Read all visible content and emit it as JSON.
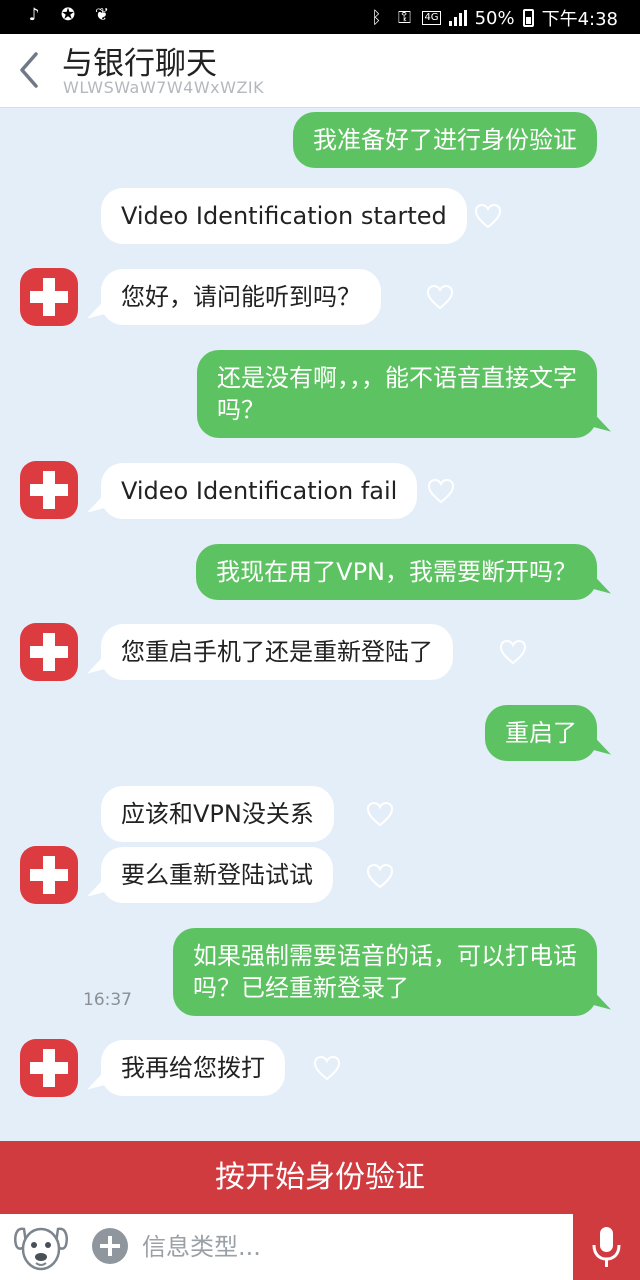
{
  "status_bar": {
    "battery": "50%",
    "time": "下午4:38",
    "network": "4G"
  },
  "header": {
    "title": "与银行聊天",
    "subtitle": "WLWSWaW7W4WxWZIK"
  },
  "messages": [
    {
      "side": "out",
      "text": "我准备好了进行身份验证"
    },
    {
      "side": "in",
      "text": "Video Identification started"
    },
    {
      "side": "in",
      "text": "您好，请问能听到吗？"
    },
    {
      "side": "out",
      "line1": "还是没有啊，，，能不语音直接文字",
      "line2": "吗？"
    },
    {
      "side": "in",
      "text": "Video Identification fail"
    },
    {
      "side": "out",
      "text": "我现在用了VPN，我需要断开吗？"
    },
    {
      "side": "in",
      "text": "您重启手机了还是重新登陆了"
    },
    {
      "side": "out",
      "text": "重启了"
    },
    {
      "side": "in",
      "text": "应该和VPN没关系"
    },
    {
      "side": "in",
      "text": "要么重新登陆试试"
    },
    {
      "side": "out",
      "line1": "如果强制需要语音的话，可以打电话",
      "line2": "吗？已经重新登录了"
    },
    {
      "side": "in",
      "text": "我再给您拨打"
    }
  ],
  "timestamp": "16:37",
  "start_button": "按开始身份验证",
  "input": {
    "placeholder": "信息类型..."
  },
  "colors": {
    "outgoing_bubble": "#5dc261",
    "incoming_bubble": "#ffffff",
    "accent_red": "#d03b40",
    "chat_background": "#e4eef9"
  },
  "icons": [
    "back-chevron-icon",
    "heart-icon",
    "swiss-cross-avatar-icon",
    "dog-avatar-icon",
    "plus-icon",
    "microphone-icon"
  ]
}
